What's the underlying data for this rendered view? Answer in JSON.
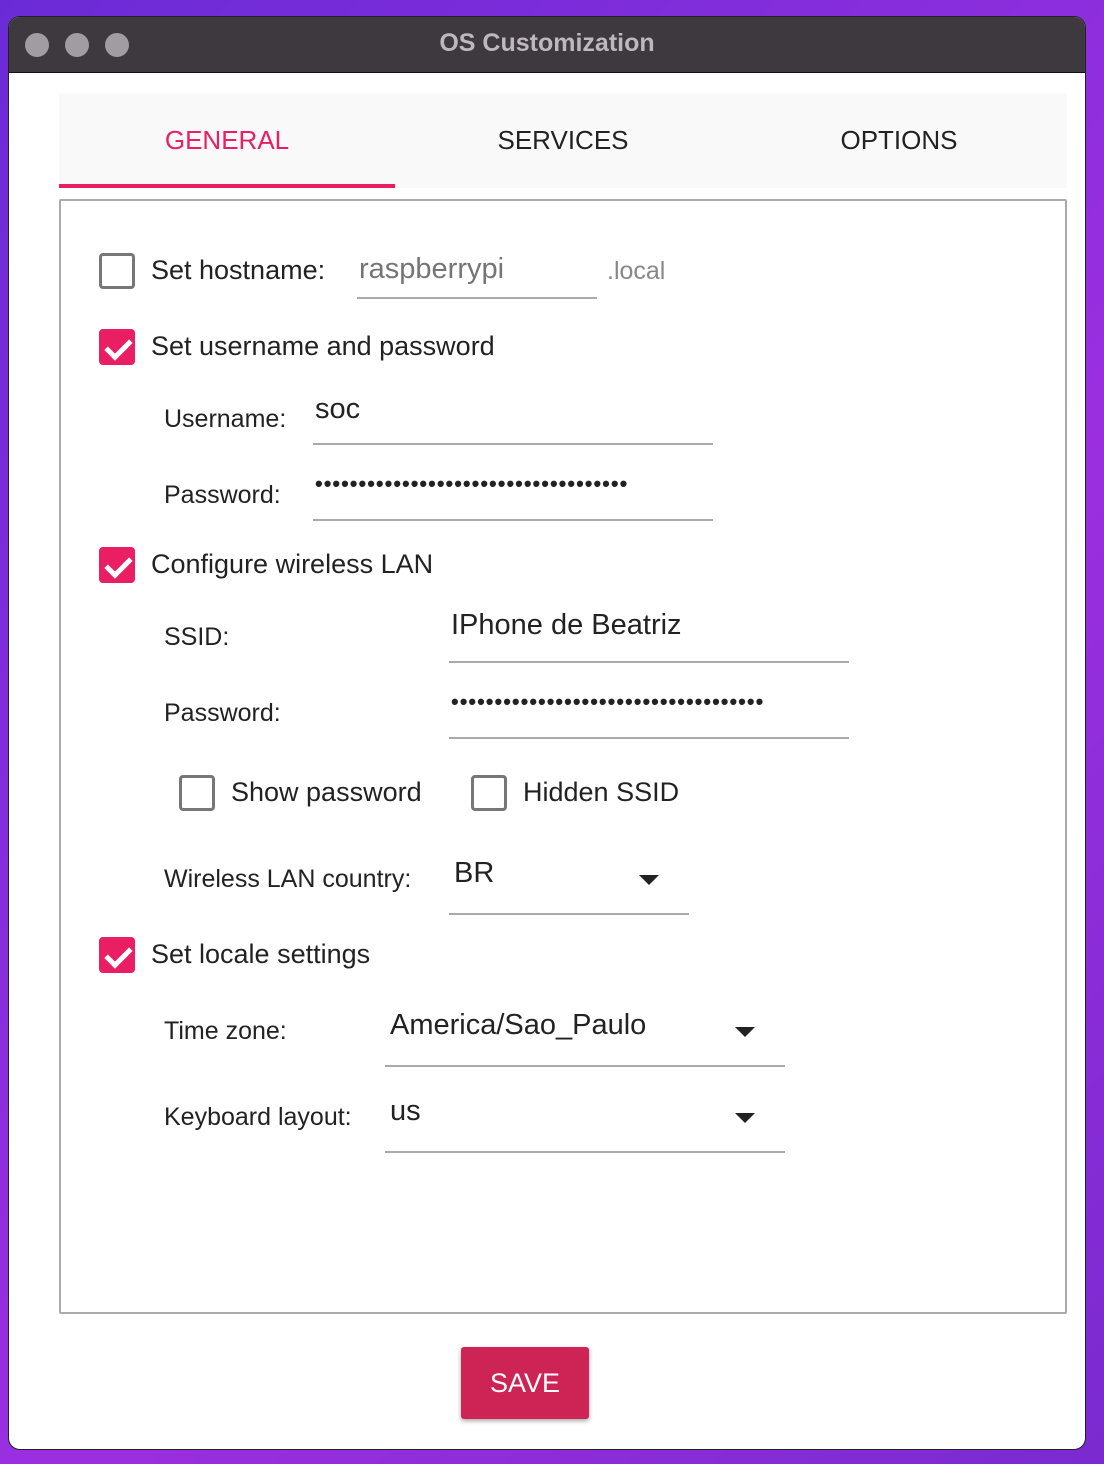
{
  "window": {
    "title": "OS Customization"
  },
  "tabs": [
    {
      "label": "GENERAL",
      "active": true
    },
    {
      "label": "SERVICES"
    },
    {
      "label": "OPTIONS"
    }
  ],
  "hostname": {
    "label": "Set hostname:",
    "checked": false,
    "placeholder": "raspberrypi",
    "suffix": ".local"
  },
  "user": {
    "label": "Set username and password",
    "checked": true,
    "username_label": "Username:",
    "username": "soc",
    "password_label": "Password:",
    "password": "••••••••••••••••••••••••••••••••••••"
  },
  "wifi": {
    "label": "Configure wireless LAN",
    "checked": true,
    "ssid_label": "SSID:",
    "ssid": "IPhone de Beatriz",
    "password_label": "Password:",
    "password": "••••••••••••••••••••••••••••••••••••",
    "show_password": "Show password",
    "hidden_ssid": "Hidden SSID",
    "country_label": "Wireless LAN country:",
    "country": "BR"
  },
  "locale": {
    "label": "Set locale settings",
    "checked": true,
    "timezone_label": "Time zone:",
    "timezone": "America/Sao_Paulo",
    "keyboard_label": "Keyboard layout:",
    "keyboard": "us"
  },
  "save_label": "SAVE",
  "colors": {
    "accent": "#e91e63",
    "save": "#cd2355"
  }
}
